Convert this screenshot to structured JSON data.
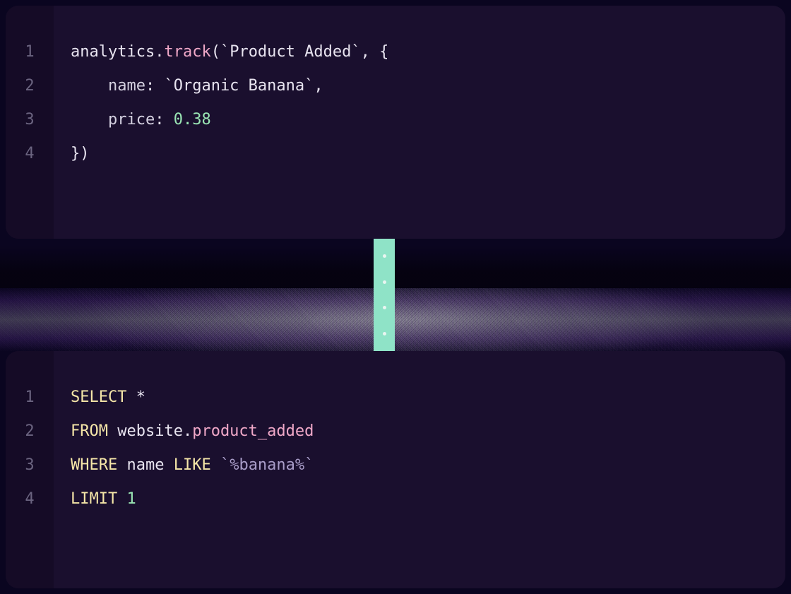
{
  "top": {
    "lineNumbers": [
      "1",
      "2",
      "3",
      "4"
    ],
    "lines": [
      {
        "tokens": [
          {
            "cls": "t-plain",
            "text": "analytics"
          },
          {
            "cls": "t-plain",
            "text": "."
          },
          {
            "cls": "t-method",
            "text": "track"
          },
          {
            "cls": "t-plain",
            "text": "("
          },
          {
            "cls": "t-string",
            "text": "`Product Added`"
          },
          {
            "cls": "t-plain",
            "text": ", {"
          }
        ]
      },
      {
        "indent": "    ",
        "tokens": [
          {
            "cls": "t-key",
            "text": "name"
          },
          {
            "cls": "t-plain",
            "text": ": "
          },
          {
            "cls": "t-string",
            "text": "`Organic Banana`"
          },
          {
            "cls": "t-plain",
            "text": ","
          }
        ]
      },
      {
        "indent": "    ",
        "tokens": [
          {
            "cls": "t-key",
            "text": "price"
          },
          {
            "cls": "t-plain",
            "text": ": "
          },
          {
            "cls": "t-num",
            "text": "0.38"
          }
        ]
      },
      {
        "tokens": [
          {
            "cls": "t-plain",
            "text": "})"
          }
        ]
      }
    ]
  },
  "bottom": {
    "lineNumbers": [
      "1",
      "2",
      "3",
      "4"
    ],
    "lines": [
      {
        "tokens": [
          {
            "cls": "t-kw",
            "text": "SELECT"
          },
          {
            "cls": "t-plain",
            "text": " *"
          }
        ]
      },
      {
        "tokens": [
          {
            "cls": "t-kw",
            "text": "FROM"
          },
          {
            "cls": "t-plain",
            "text": " website."
          },
          {
            "cls": "t-field",
            "text": "product_added"
          }
        ]
      },
      {
        "tokens": [
          {
            "cls": "t-kw",
            "text": "WHERE"
          },
          {
            "cls": "t-plain",
            "text": " name "
          },
          {
            "cls": "t-kw",
            "text": "LIKE"
          },
          {
            "cls": "t-plain",
            "text": " "
          },
          {
            "cls": "t-str2",
            "text": "`%banana%`"
          }
        ]
      },
      {
        "tokens": [
          {
            "cls": "t-kw",
            "text": "LIMIT"
          },
          {
            "cls": "t-plain",
            "text": " "
          },
          {
            "cls": "t-num",
            "text": "1"
          }
        ]
      }
    ]
  },
  "connector": {
    "dots": 4
  }
}
